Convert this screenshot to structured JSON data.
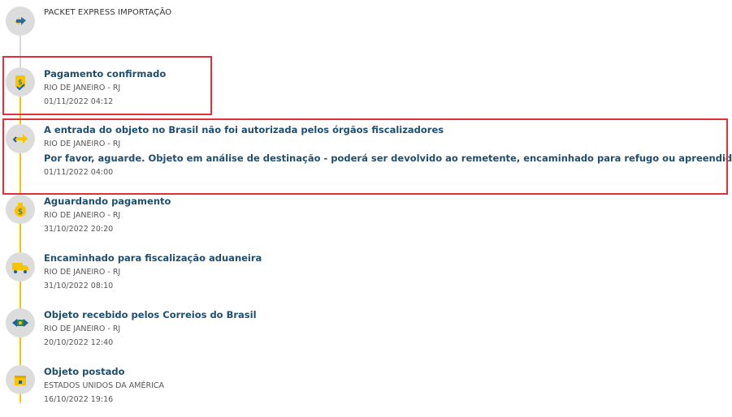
{
  "header": {
    "title": "PACKET EXPRESS IMPORTAÇÃO"
  },
  "events": [
    {
      "title": "Pagamento confirmado",
      "location": "RIO DE JANEIRO - RJ",
      "datetime": "01/11/2022 04:12"
    },
    {
      "title": "A entrada do objeto no Brasil não foi autorizada pelos órgãos fiscalizadores",
      "location": "RIO DE JANEIRO - RJ",
      "detail": "Por favor, aguarde. Objeto em análise de destinação - poderá ser devolvido ao remetente, encaminhado para refugo ou apreendido.",
      "datetime": "01/11/2022 04:00"
    },
    {
      "title": "Aguardando pagamento",
      "location": "RIO DE JANEIRO - RJ",
      "datetime": "31/10/2022 20:20"
    },
    {
      "title": "Encaminhado para fiscalização aduaneira",
      "location": "RIO DE JANEIRO - RJ",
      "datetime": "31/10/2022 08:10"
    },
    {
      "title": "Objeto recebido pelos Correios do Brasil",
      "location": "RIO DE JANEIRO - RJ",
      "datetime": "20/10/2022 12:40"
    },
    {
      "title": "Objeto postado",
      "location": "ESTADOS UNIDOS DA AMÉRICA",
      "datetime": "16/10/2022 19:16"
    }
  ],
  "icons": {
    "header": "package-swap-icon",
    "e0": "payment-confirmed-icon",
    "e1": "return-arrow-icon",
    "e2": "money-bag-icon",
    "e3": "customs-truck-icon",
    "e4": "package-received-icon",
    "e5": "box-posted-icon"
  },
  "colors": {
    "accent": "#f6c400",
    "title": "#1f4e6e",
    "highlight": "#e0303a"
  }
}
